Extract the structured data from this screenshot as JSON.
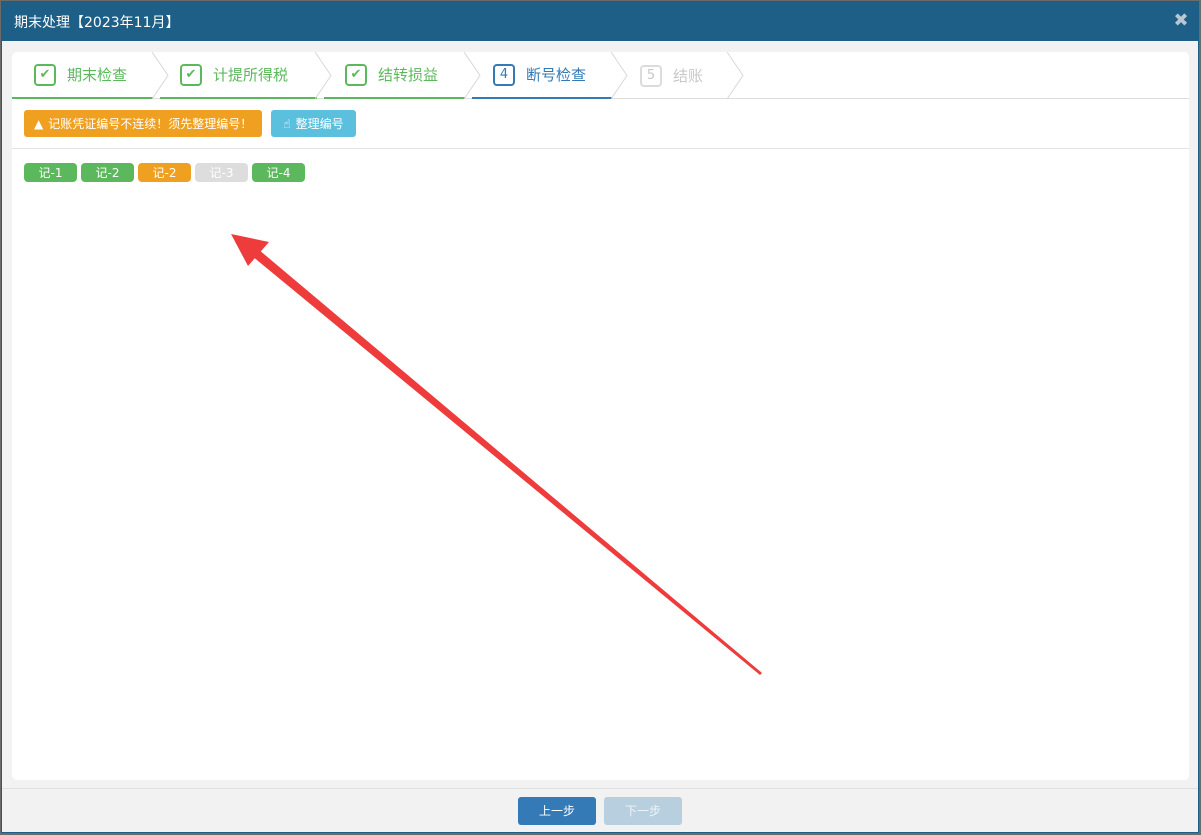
{
  "dialog": {
    "title": "期末处理【2023年11月】",
    "close_symbol": "✖"
  },
  "steps": [
    {
      "label": "期末检查",
      "state": "done",
      "marker": "✔"
    },
    {
      "label": "计提所得税",
      "state": "done",
      "marker": "✔"
    },
    {
      "label": "结转损益",
      "state": "done",
      "marker": "✔"
    },
    {
      "label": "断号检查",
      "state": "active",
      "marker": "4"
    },
    {
      "label": "结账",
      "state": "todo",
      "marker": "5"
    }
  ],
  "toolbar": {
    "warning_text": "记账凭证编号不连续！须先整理编号！",
    "fix_label": "整理编号"
  },
  "voucher_tags": [
    {
      "label": "记-1",
      "color": "#5cb85c"
    },
    {
      "label": "记-2",
      "color": "#5cb85c"
    },
    {
      "label": "记-2",
      "color": "#f0a020"
    },
    {
      "label": "记-3",
      "color": "#dddddd"
    },
    {
      "label": "记-4",
      "color": "#5cb85c"
    }
  ],
  "footer": {
    "prev_label": "上一步",
    "next_label": "下一步"
  },
  "colors": {
    "header": "#1e5f87",
    "done": "#5cb85c",
    "active": "#337ab7",
    "warning": "#f0a020",
    "info": "#5bc0de",
    "annotation_arrow": "#ee3b3b"
  }
}
